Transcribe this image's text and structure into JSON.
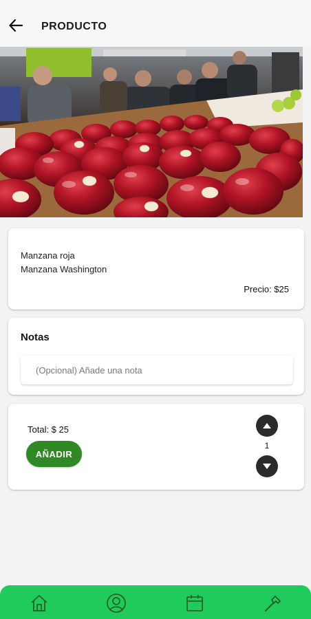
{
  "header": {
    "title": "PRODUCTO",
    "back_icon": "arrow-left-icon"
  },
  "hero": {
    "image_subject": "red-apples-crate-photo"
  },
  "product": {
    "name": "Manzana roja",
    "variety": "Manzana Washington",
    "price_label": "Precio: $25"
  },
  "notes": {
    "title": "Notas",
    "placeholder": "(Opcional) Añade una nota",
    "value": ""
  },
  "order": {
    "total_label": "Total: $ 25",
    "add_label": "AÑADIR",
    "quantity": "1",
    "increment_icon": "chevron-up-icon",
    "decrement_icon": "chevron-down-icon"
  },
  "bottom_nav": {
    "items": [
      {
        "icon": "home-icon"
      },
      {
        "icon": "user-icon"
      },
      {
        "icon": "calendar-icon"
      },
      {
        "icon": "hammer-icon"
      }
    ]
  },
  "colors": {
    "accent_green": "#2f8a25",
    "nav_green": "#1fcc5b",
    "stepper_dark": "#2b2b2b",
    "background": "#f2f3f5"
  }
}
